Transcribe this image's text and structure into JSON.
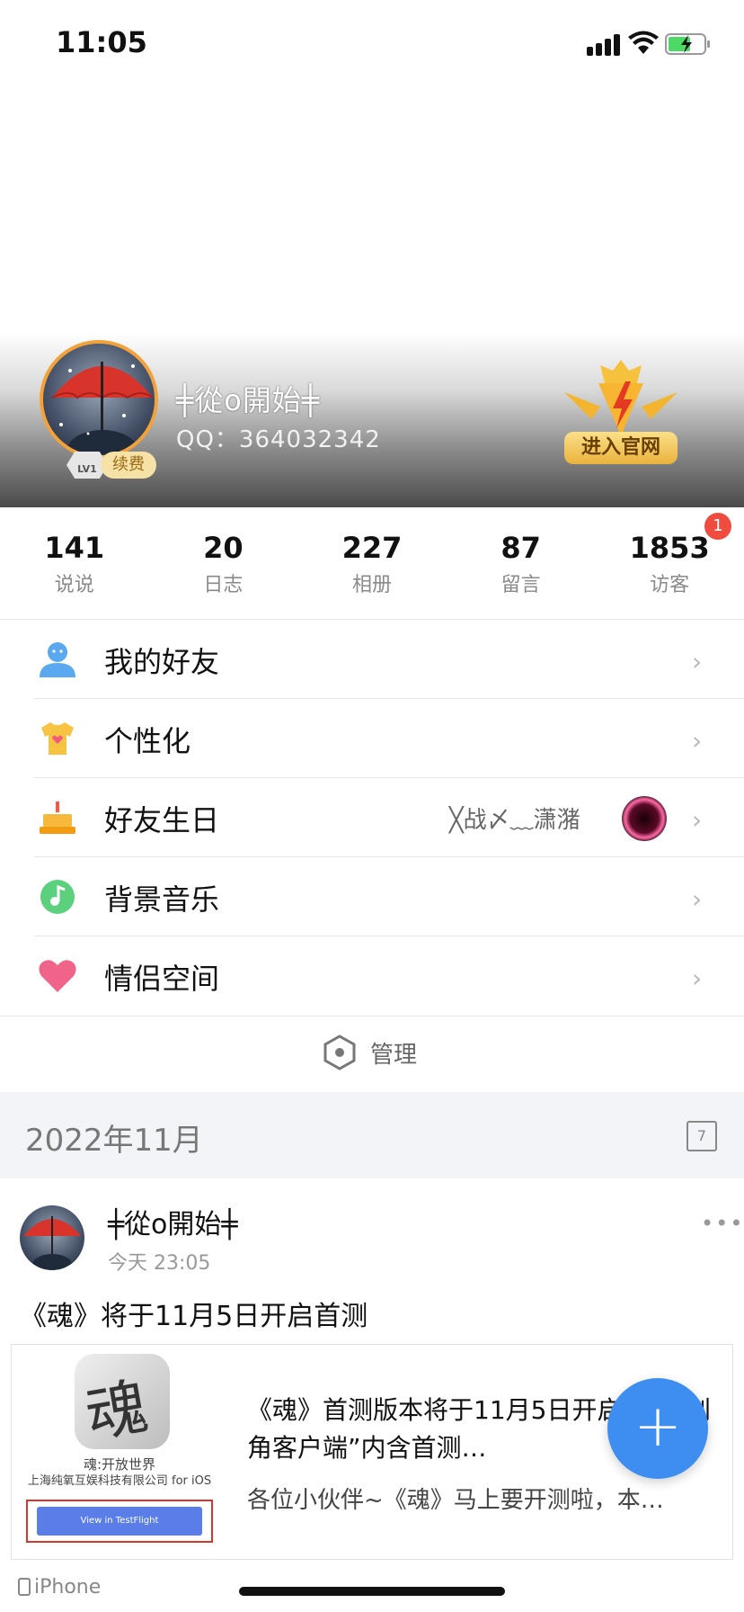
{
  "status_bar": {
    "time": "11:05"
  },
  "profile": {
    "nickname": "╪從ο開始╪",
    "qq": "QQ：364032342",
    "level": "LV1",
    "renew_label": "续费",
    "official_label": "进入官网"
  },
  "stats": [
    {
      "value": "141",
      "label": "说说"
    },
    {
      "value": "20",
      "label": "日志"
    },
    {
      "value": "227",
      "label": "相册"
    },
    {
      "value": "87",
      "label": "留言"
    },
    {
      "value": "1853",
      "label": "访客",
      "badge": "1"
    }
  ],
  "menu": [
    {
      "label": "我的好友",
      "icon": "friend-icon"
    },
    {
      "label": "个性化",
      "icon": "shirt-icon"
    },
    {
      "label": "好友生日",
      "icon": "cake-icon",
      "extra": "╳战〆﹏潇潴"
    },
    {
      "label": "背景音乐",
      "icon": "music-icon"
    },
    {
      "label": "情侣空间",
      "icon": "heart-icon"
    }
  ],
  "manage_label": "管理",
  "month_label": "2022年11月",
  "calendar_day": "7",
  "post": {
    "author": "╪從ο開始╪",
    "time": "今天 23:05",
    "text": "《魂》将于11月5日开启首测",
    "share": {
      "app_glyph": "魂",
      "app_name": "魂:开放世界",
      "app_dev": "上海纯氧互娱科技有限公司 for iOS",
      "testflight_label": "View in TestFlight",
      "title": "《魂》首测版本将于11月5日开启（“预创角客户端”内含首测…",
      "desc": "各位小伙伴~《魂》马上要开测啦，本…"
    },
    "device": "iPhone"
  },
  "colors": {
    "accent": "#3d8ef0",
    "badge": "#f04b3f"
  }
}
